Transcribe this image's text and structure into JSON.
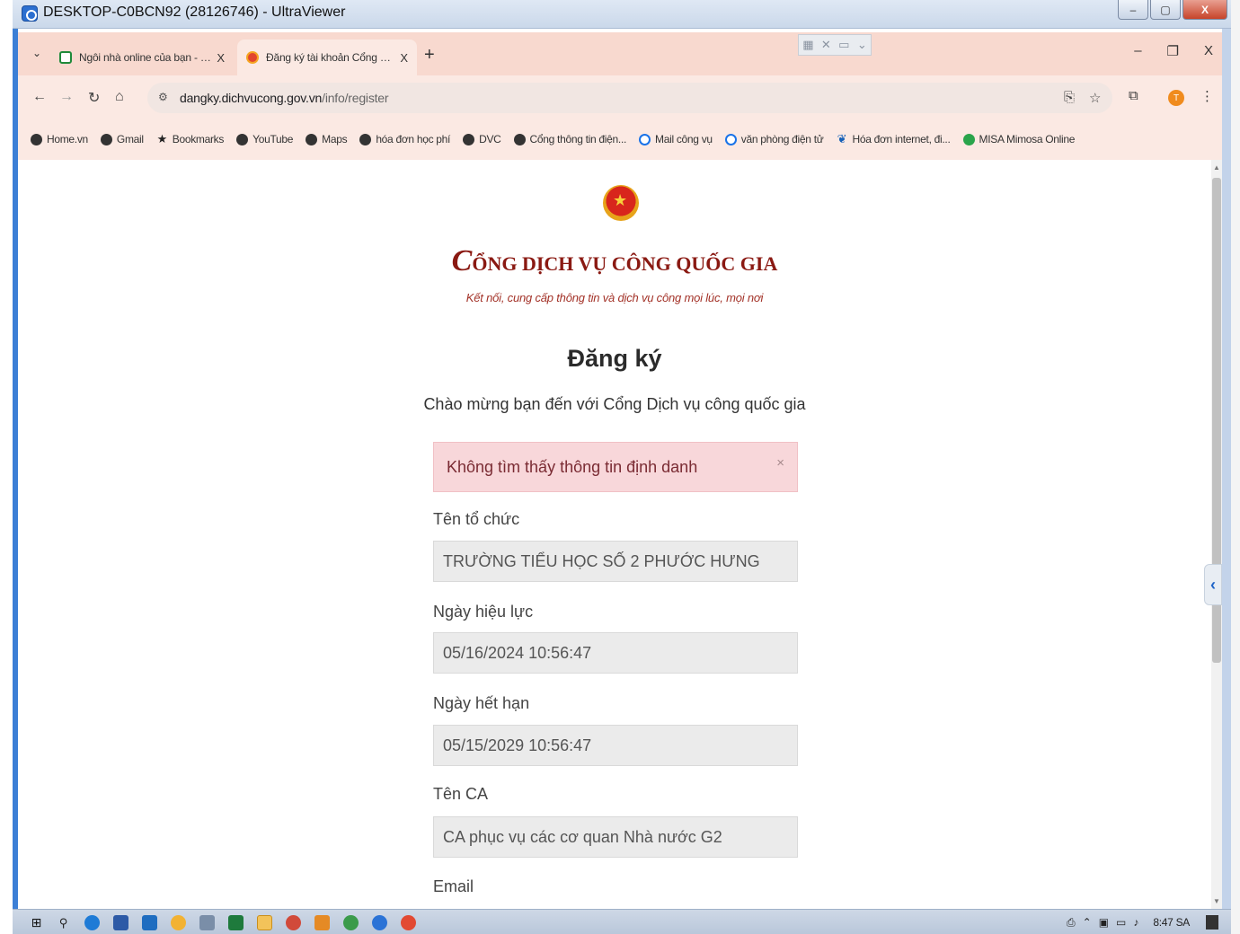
{
  "window": {
    "title": "DESKTOP-C0BCN92 (28126746) - UltraViewer",
    "min_glyph": "–",
    "max_glyph": "▢",
    "close_glyph": "X"
  },
  "browser": {
    "tabs": [
      {
        "label": "Ngôi nhà online của bạn - Hom",
        "icon": "home-favicon",
        "close": "X"
      },
      {
        "label": "Đăng ký tài khoản Cổng DVC q",
        "icon": "dvc-favicon",
        "close": "X"
      }
    ],
    "new_tab": "+",
    "window_controls": {
      "minimize": "–",
      "restore": "❐",
      "close": "X"
    },
    "url_host": "dangky.dichvucong.gov.vn",
    "url_path": "/info/register",
    "bookmarks": [
      {
        "label": "Home.vn",
        "icon": "globe-icon"
      },
      {
        "label": "Gmail",
        "icon": "globe-icon"
      },
      {
        "label": "Bookmarks",
        "icon": "star-icon"
      },
      {
        "label": "YouTube",
        "icon": "globe-icon"
      },
      {
        "label": "Maps",
        "icon": "globe-icon"
      },
      {
        "label": "hóa đơn học phí",
        "icon": "globe-icon"
      },
      {
        "label": "DVC",
        "icon": "globe-icon"
      },
      {
        "label": "Cổng thông tin điện...",
        "icon": "globe-icon"
      },
      {
        "label": "Mail công vụ",
        "icon": "blue-circle-icon"
      },
      {
        "label": "văn phòng điện tử",
        "icon": "blue-circle-icon"
      },
      {
        "label": "Hóa đơn internet, đi...",
        "icon": "feather-icon"
      },
      {
        "label": "MISA Mimosa Online",
        "icon": "misa-icon"
      }
    ]
  },
  "page": {
    "logo_title_initial": "C",
    "logo_title_rest": "ỔNG DỊCH VỤ CÔNG QUỐC GIA",
    "logo_subtitle": "Kết nối, cung cấp thông tin và dịch vụ công mọi lúc, mọi nơi",
    "heading": "Đăng ký",
    "welcome": "Chào mừng bạn đến với Cổng Dịch vụ công quốc gia",
    "alert": {
      "text": "Không tìm thấy thông tin định danh",
      "close": "×"
    },
    "fields": [
      {
        "label": "Tên tổ chức",
        "value": "TRƯỜNG TIỂU HỌC SỐ 2 PHƯỚC HƯNG"
      },
      {
        "label": "Ngày hiệu lực",
        "value": "05/16/2024 10:56:47"
      },
      {
        "label": "Ngày hết hạn",
        "value": "05/15/2029 10:56:47"
      },
      {
        "label": "Tên CA",
        "value": "CA phục vụ các cơ quan Nhà nước G2"
      },
      {
        "label": "Email",
        "value": ""
      }
    ]
  },
  "taskbar": {
    "clock": "8:47 SA",
    "profile_initial": "T"
  },
  "colors": {
    "tab_strip": "#f8d9cf",
    "toolbar": "#fbe9e3",
    "alert_bg": "#f8d7da",
    "logo_red": "#8a1912",
    "field_bg": "#ebebeb"
  }
}
